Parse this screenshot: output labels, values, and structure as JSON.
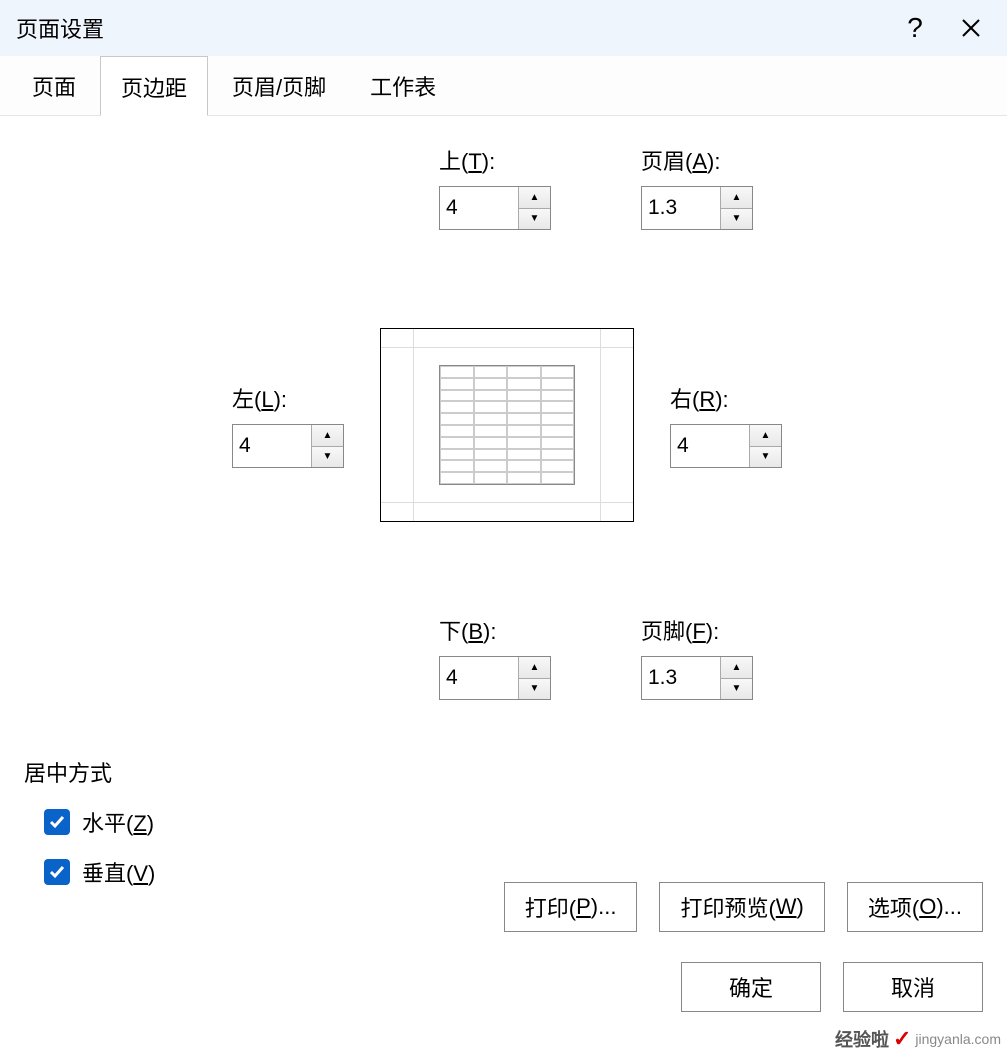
{
  "title": "页面设置",
  "tabs": {
    "page": "页面",
    "margins": "页边距",
    "header_footer": "页眉/页脚",
    "sheet": "工作表"
  },
  "margins": {
    "top": {
      "label_pre": "上(",
      "mn": "T",
      "label_post": "):",
      "value": "4"
    },
    "header": {
      "label_pre": "页眉(",
      "mn": "A",
      "label_post": "):",
      "value": "1.3"
    },
    "left": {
      "label_pre": "左(",
      "mn": "L",
      "label_post": "):",
      "value": "4"
    },
    "right": {
      "label_pre": "右(",
      "mn": "R",
      "label_post": "):",
      "value": "4"
    },
    "bottom": {
      "label_pre": "下(",
      "mn": "B",
      "label_post": "):",
      "value": "4"
    },
    "footer": {
      "label_pre": "页脚(",
      "mn": "F",
      "label_post": "):",
      "value": "1.3"
    }
  },
  "center": {
    "heading": "居中方式",
    "horizontal": {
      "label_pre": "水平(",
      "mn": "Z",
      "label_post": ")",
      "checked": true
    },
    "vertical": {
      "label_pre": "垂直(",
      "mn": "V",
      "label_post": ")",
      "checked": true
    }
  },
  "buttons": {
    "print": {
      "pre": "打印(",
      "mn": "P",
      "post": ")..."
    },
    "preview": {
      "pre": "打印预览(",
      "mn": "W",
      "post": ")"
    },
    "options": {
      "pre": "选项(",
      "mn": "O",
      "post": ")..."
    },
    "ok": "确定",
    "cancel": "取消"
  },
  "watermark": {
    "brand": "经验啦",
    "site": "jingyanla.com"
  }
}
